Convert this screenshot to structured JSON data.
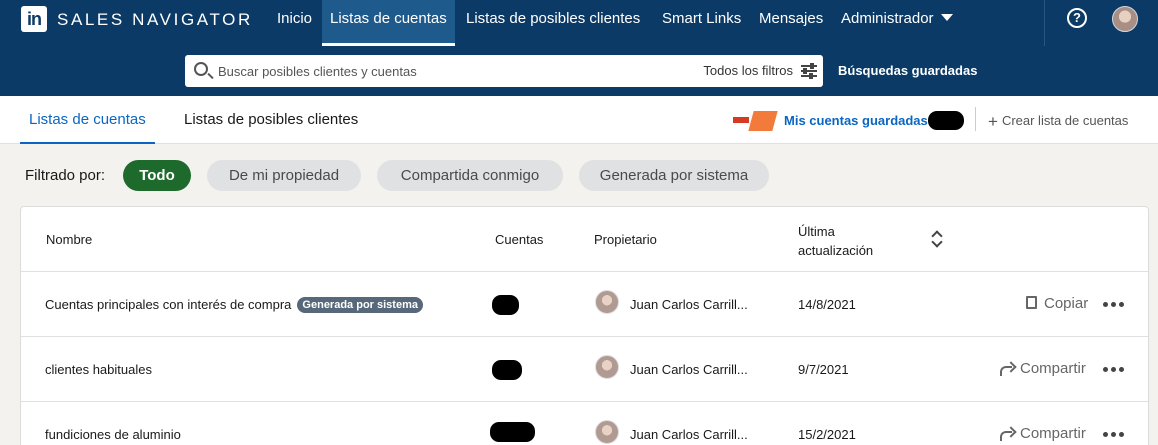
{
  "nav": {
    "logo": "in",
    "brand": "SALES NAVIGATOR",
    "items": [
      {
        "label": "Inicio"
      },
      {
        "label": "Listas de cuentas",
        "active": true
      },
      {
        "label": "Listas de posibles clientes"
      },
      {
        "label": "Smart Links"
      },
      {
        "label": "Mensajes"
      },
      {
        "label": "Administrador"
      }
    ],
    "help": "?"
  },
  "search": {
    "placeholder": "Buscar posibles clientes y cuentas",
    "filters_label": "Todos los filtros",
    "saved_searches": "Búsquedas guardadas"
  },
  "tabs": {
    "accounts": "Listas de cuentas",
    "leads": "Listas de posibles clientes",
    "my_saved": "Mis cuentas guardadas",
    "create": "Crear lista de cuentas"
  },
  "filters": {
    "label": "Filtrado por:",
    "pills": [
      {
        "label": "Todo",
        "active": true
      },
      {
        "label": "De mi propiedad"
      },
      {
        "label": "Compartida conmigo"
      },
      {
        "label": "Generada por sistema"
      }
    ]
  },
  "table": {
    "headers": {
      "name": "Nombre",
      "accounts": "Cuentas",
      "owner": "Propietario",
      "updated_line1": "Última",
      "updated_line2": "actualización"
    },
    "rows": [
      {
        "name": "Cuentas principales con interés de compra",
        "badge": "Generada por sistema",
        "owner": "Juan Carlos Carrill...",
        "date": "14/8/2021",
        "action": "Copiar",
        "action_icon": "copy-icon"
      },
      {
        "name": "clientes habituales",
        "badge": "",
        "owner": "Juan Carlos Carrill...",
        "date": "9/7/2021",
        "action": "Compartir",
        "action_icon": "share-icon"
      },
      {
        "name": "fundiciones de aluminio",
        "badge": "",
        "owner": "Juan Carlos Carrill...",
        "date": "15/2/2021",
        "action": "Compartir",
        "action_icon": "share-icon"
      }
    ]
  },
  "colors": {
    "nav_bg": "#0b3a66",
    "accent": "#0a66c2",
    "active_pill": "#1e6a2c"
  }
}
